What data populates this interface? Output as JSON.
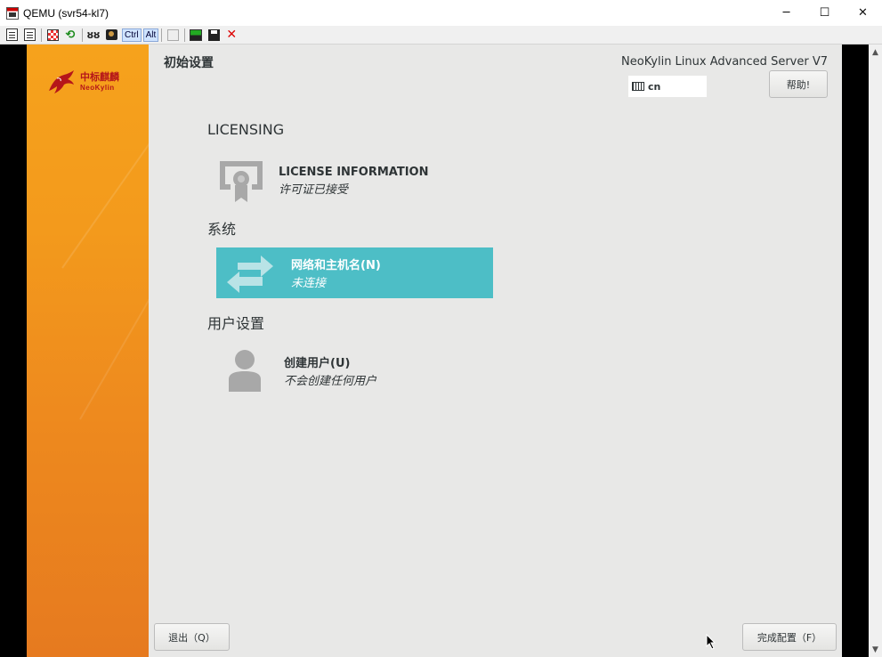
{
  "window": {
    "title": "QEMU (svr54-kl7)",
    "minimize": "─",
    "maximize": "☐",
    "close": "✕"
  },
  "toolbar": {
    "ctrl": "Ctrl",
    "alt": "Alt"
  },
  "sidebar": {
    "logo_cn": "中标麒麟",
    "logo_en": "NeoKylin"
  },
  "header": {
    "title": "初始设置",
    "product": "NeoKylin Linux Advanced Server V7",
    "keyboard_layout": "cn",
    "help_label": "帮助!"
  },
  "sections": [
    {
      "title": "LICENSING",
      "spokes": [
        {
          "name": "LICENSE INFORMATION",
          "status": "许可证已接受",
          "icon": "license-icon"
        }
      ]
    },
    {
      "title": "系统",
      "spokes": [
        {
          "name": "网络和主机名(N)",
          "status": "未连接",
          "icon": "network-arrows-icon",
          "selected": true
        }
      ]
    },
    {
      "title": "用户设置",
      "spokes": [
        {
          "name": "创建用户(U)",
          "status": "不会创建任何用户",
          "icon": "user-icon"
        }
      ]
    }
  ],
  "footer": {
    "quit_label": "退出（Q）",
    "finish_label": "完成配置（F）"
  },
  "colors": {
    "sidebar": "#f39a1c",
    "selected_spoke": "#4dbec6",
    "background": "#e8e8e7"
  }
}
